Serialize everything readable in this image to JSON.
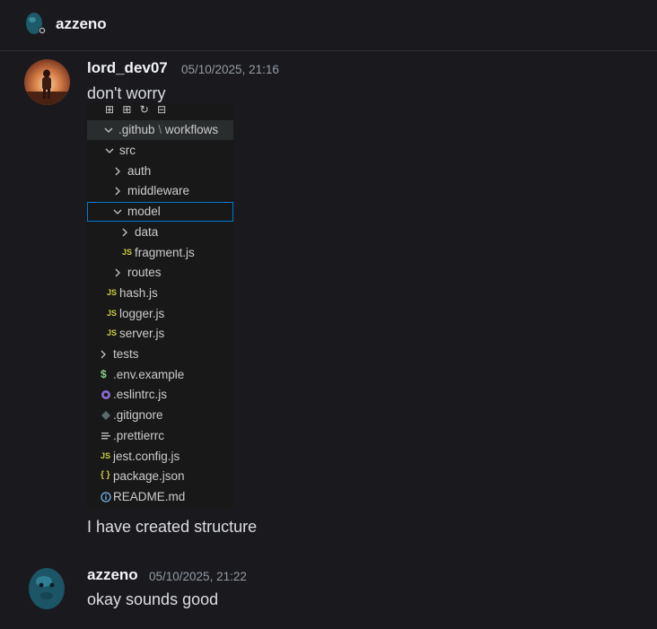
{
  "channel": {
    "title": "azzeno"
  },
  "messages": [
    {
      "username": "lord_dev07",
      "timestamp": "05/10/2025, 21:16",
      "text": "don't worry",
      "caption": "I have created structure"
    },
    {
      "username": "azzeno",
      "timestamp": "05/10/2025, 21:22",
      "text": "okay sounds good"
    }
  ],
  "explorer": {
    "github_folder_a": ".github",
    "github_sep": "\\",
    "github_folder_b": "workflows",
    "items": [
      {
        "label": "src",
        "icon": "chevron-down"
      },
      {
        "label": "auth",
        "icon": "chevron-right"
      },
      {
        "label": "middleware",
        "icon": "chevron-right"
      },
      {
        "label": "model",
        "icon": "chevron-down"
      },
      {
        "label": "data",
        "icon": "chevron-right"
      },
      {
        "label": "fragment.js",
        "icon": "js"
      },
      {
        "label": "routes",
        "icon": "chevron-right"
      },
      {
        "label": "hash.js",
        "icon": "js"
      },
      {
        "label": "logger.js",
        "icon": "js"
      },
      {
        "label": "server.js",
        "icon": "js"
      },
      {
        "label": "tests",
        "icon": "chevron-right"
      },
      {
        "label": ".env.example",
        "icon": "dollar"
      },
      {
        "label": ".eslintrc.js",
        "icon": "eslint"
      },
      {
        "label": ".gitignore",
        "icon": "git"
      },
      {
        "label": ".prettierrc",
        "icon": "lines"
      },
      {
        "label": "jest.config.js",
        "icon": "js"
      },
      {
        "label": "package.json",
        "icon": "braces"
      },
      {
        "label": "README.md",
        "icon": "info"
      }
    ],
    "js_badge": "JS",
    "dollar_badge": "$",
    "braces_badge": "{ }"
  },
  "colors": {
    "background": "#1a1a1e",
    "username": "#f2f3f5",
    "timestamp": "#949ba4",
    "text": "#dbdee1",
    "js": "#cbcb41",
    "selection": "#0078d4"
  }
}
